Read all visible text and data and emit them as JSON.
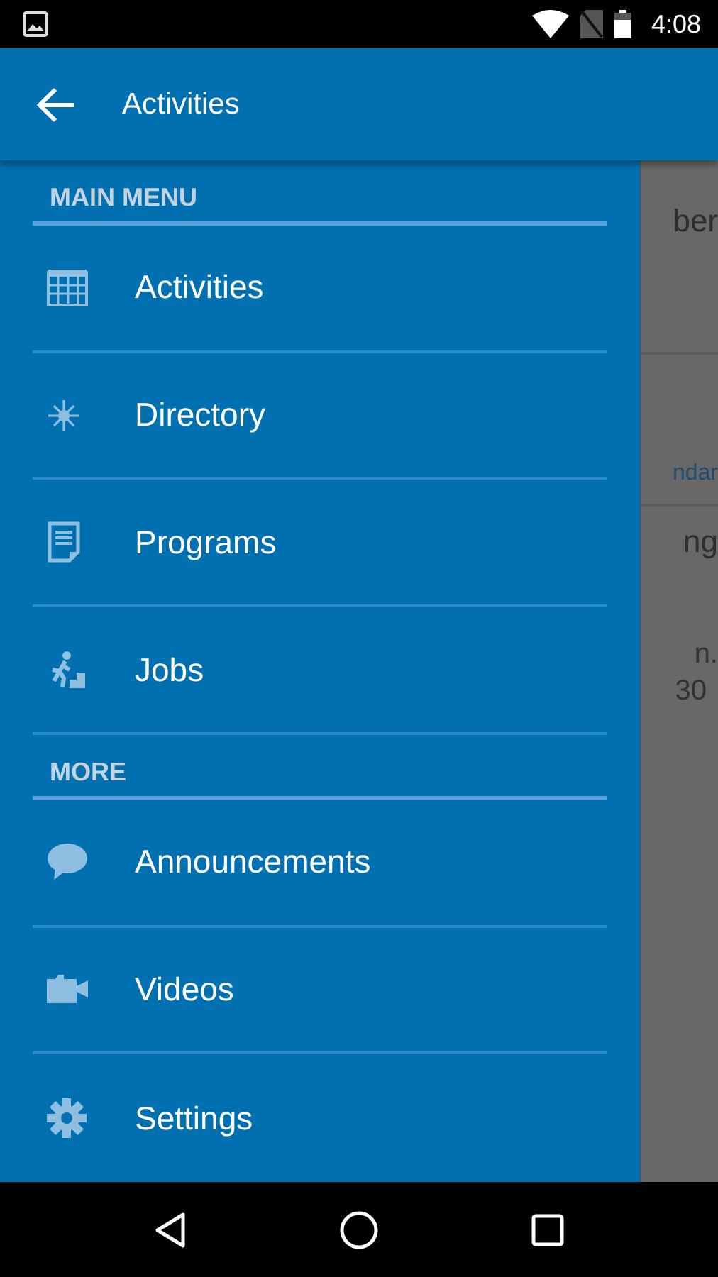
{
  "status_bar": {
    "time": "4:08"
  },
  "app_bar": {
    "title": "Activities"
  },
  "drawer": {
    "sections": [
      {
        "header": "MAIN MENU",
        "items": [
          {
            "label": "Activities"
          },
          {
            "label": "Directory"
          },
          {
            "label": "Programs"
          },
          {
            "label": "Jobs"
          }
        ]
      },
      {
        "header": "MORE",
        "items": [
          {
            "label": "Announcements"
          },
          {
            "label": "Videos"
          },
          {
            "label": "Settings"
          }
        ]
      }
    ]
  },
  "background_content": {
    "texts": [
      {
        "text": "ber",
        "kind": "title"
      },
      {
        "text": "ndar",
        "kind": "link"
      },
      {
        "text": "ng",
        "kind": "title"
      },
      {
        "text": "n.",
        "kind": "body"
      },
      {
        "text": "30",
        "kind": "body"
      }
    ]
  }
}
